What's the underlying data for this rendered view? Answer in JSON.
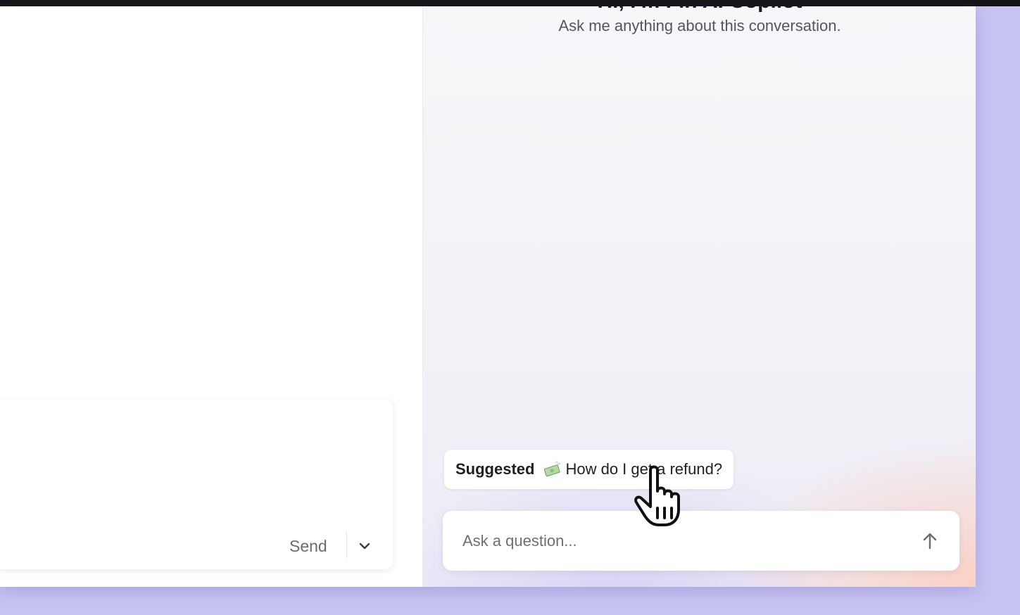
{
  "composer": {
    "send_label": "Send",
    "dropdown_icon": "chevron-down-icon"
  },
  "copilot": {
    "title": "Hi, I'm Fin AI Copilot",
    "subtitle": "Ask me anything about this conversation.",
    "suggestion": {
      "label": "Suggested",
      "emoji_icon": "money-with-wings-icon",
      "text": "How do I get a refund?"
    },
    "input": {
      "placeholder": "Ask a question...",
      "value": ""
    },
    "submit_icon": "arrow-up-icon"
  },
  "colors": {
    "backdrop": "#c7c4f2",
    "accent_peach": "#fccdbe",
    "text_primary": "#1f1f24",
    "text_secondary": "#6e6e76"
  }
}
